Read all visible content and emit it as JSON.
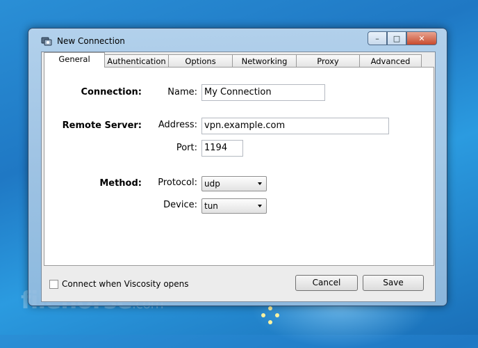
{
  "window": {
    "title": "New Connection"
  },
  "tabs": [
    "General",
    "Authentication",
    "Options",
    "Networking",
    "Proxy",
    "Advanced"
  ],
  "general": {
    "connection_section": "Connection:",
    "name_label": "Name:",
    "name_value": "My Connection",
    "remote_section": "Remote Server:",
    "address_label": "Address:",
    "address_value": "vpn.example.com",
    "port_label": "Port:",
    "port_value": "1194",
    "method_section": "Method:",
    "protocol_label": "Protocol:",
    "protocol_value": "udp",
    "device_label": "Device:",
    "device_value": "tun"
  },
  "footer": {
    "connect_checkbox_label": "Connect when Viscosity opens",
    "connect_checked": false,
    "cancel_label": "Cancel",
    "save_label": "Save"
  },
  "watermark": {
    "main": "filehorse",
    "suffix": ".com"
  },
  "colors": {
    "desktop": "#1f78c4",
    "client_bg": "#ececec",
    "close_button": "#c84a2e"
  }
}
